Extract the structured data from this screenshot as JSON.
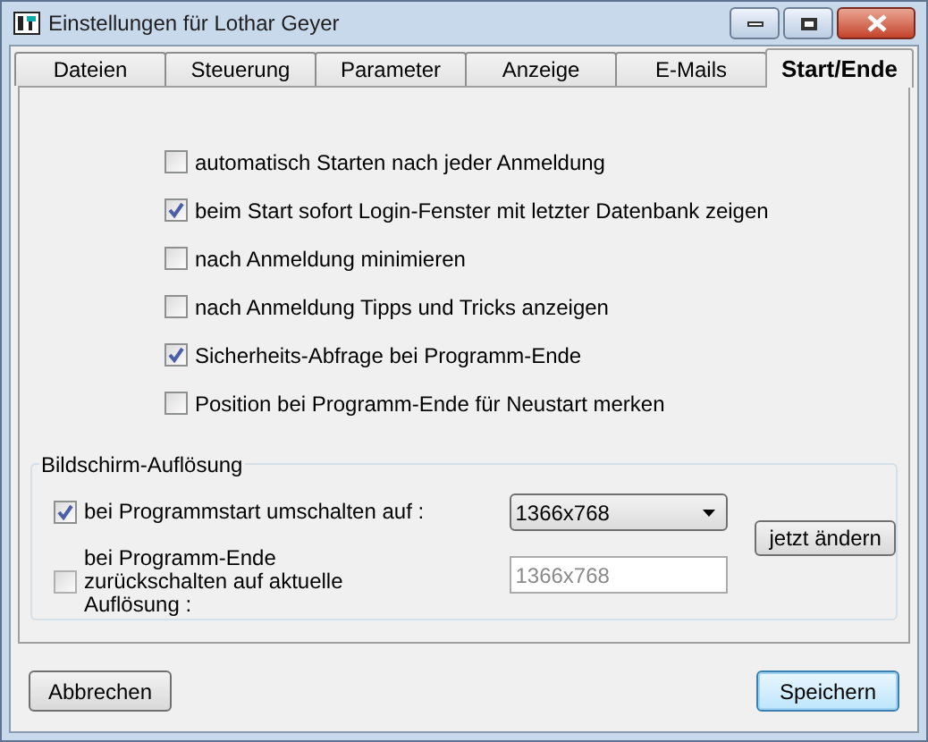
{
  "window": {
    "title": "Einstellungen für Lothar Geyer"
  },
  "tabs": [
    {
      "label": "Dateien",
      "selected": false
    },
    {
      "label": "Steuerung",
      "selected": false
    },
    {
      "label": "Parameter",
      "selected": false
    },
    {
      "label": "Anzeige",
      "selected": false
    },
    {
      "label": "E-Mails",
      "selected": false
    },
    {
      "label": "Start/Ende",
      "selected": true
    }
  ],
  "options": [
    {
      "label": "automatisch Starten nach jeder Anmeldung",
      "checked": false
    },
    {
      "label": "beim Start sofort Login-Fenster mit letzter Datenbank zeigen",
      "checked": true
    },
    {
      "label": "nach Anmeldung minimieren",
      "checked": false
    },
    {
      "label": "nach Anmeldung Tipps und Tricks anzeigen",
      "checked": false
    },
    {
      "label": "Sicherheits-Abfrage bei Programm-Ende",
      "checked": true
    },
    {
      "label": "Position bei Programm-Ende für Neustart merken",
      "checked": false
    }
  ],
  "resolution_group": {
    "title": "Bildschirm-Auflösung",
    "switch_on_start": {
      "label": "bei Programmstart umschalten auf :",
      "checked": true,
      "value": "1366x768"
    },
    "switch_back_on_exit": {
      "label": "bei Programm-Ende zurückschalten auf aktuelle Auflösung :",
      "checked": false,
      "value": "1366x768",
      "disabled": true
    },
    "apply_button": "jetzt ändern"
  },
  "buttons": [
    {
      "label": "Abbrechen",
      "default": false
    },
    {
      "label": "Speichern",
      "default": true
    }
  ]
}
